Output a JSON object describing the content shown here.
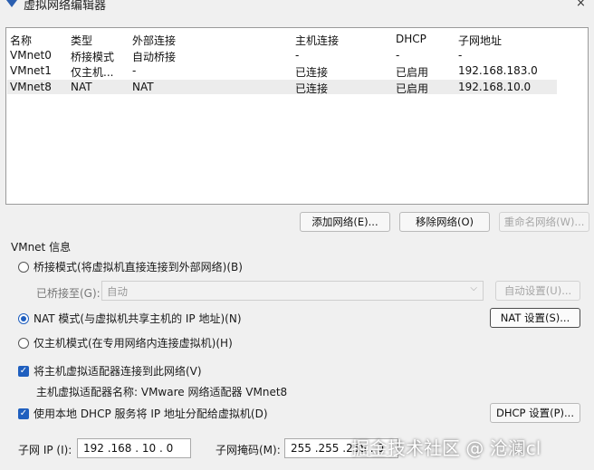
{
  "window": {
    "title": "虚拟网络编辑器",
    "close": "×"
  },
  "table": {
    "headers": [
      "名称",
      "类型",
      "外部连接",
      "主机连接",
      "DHCP",
      "子网地址"
    ],
    "rows": [
      [
        "VMnet0",
        "桥接模式",
        "自动桥接",
        "-",
        "-",
        "-"
      ],
      [
        "VMnet1",
        "仅主机...",
        "-",
        "已连接",
        "已启用",
        "192.168.183.0"
      ],
      [
        "VMnet8",
        "NAT",
        "NAT",
        "已连接",
        "已启用",
        "192.168.10.0"
      ]
    ]
  },
  "buttons": {
    "add_network": "添加网络(E)...",
    "remove_network": "移除网络(O)",
    "rename_network": "重命名网络(W)...",
    "auto_settings": "自动设置(U)...",
    "nat_settings": "NAT 设置(S)...",
    "dhcp_settings": "DHCP 设置(P)..."
  },
  "vmnet_info": {
    "label": "VMnet 信息",
    "bridge_mode": "桥接模式(将虚拟机直接连接到外部网络)(B)",
    "bridged_to_label": "已桥接至(G):",
    "bridged_to_value": "自动",
    "nat_mode": "NAT 模式(与虚拟机共享主机的 IP 地址)(N)",
    "host_only_mode": "仅主机模式(在专用网络内连接虚拟机)(H)",
    "selected_mode": "nat",
    "connect_adapter": "将主机虚拟适配器连接到此网络(V)",
    "adapter_name_label": "主机虚拟适配器名称: VMware 网络适配器 VMnet8",
    "use_dhcp": "使用本地 DHCP 服务将 IP 地址分配给虚拟机(D)",
    "subnet_ip_label": "子网 IP (I):",
    "subnet_ip_value": "192 .168 . 10  .  0",
    "subnet_mask_label": "子网掩码(M):",
    "subnet_mask_value": "255 .255 .255 .  0"
  },
  "watermark": "掘金技术社区 @ 沧澜cl"
}
